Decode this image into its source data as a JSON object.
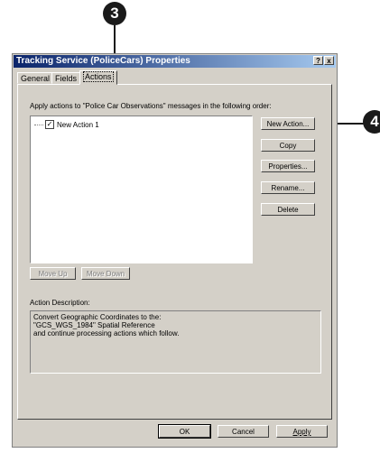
{
  "callouts": {
    "step3": "3",
    "step4": "4"
  },
  "window": {
    "title": "Tracking Service (PoliceCars) Properties",
    "help_button": "?",
    "close_button": "x"
  },
  "tabs": [
    {
      "label": "General"
    },
    {
      "label": "Fields"
    },
    {
      "label": "Actions",
      "active": true
    }
  ],
  "actions": {
    "instruction": "Apply actions to \"Police Car Observations\" messages in the following order:",
    "items": [
      {
        "label": "New Action 1",
        "checked": true
      }
    ],
    "buttons": {
      "new_action": "New Action...",
      "copy": "Copy",
      "properties": "Properties...",
      "rename": "Rename...",
      "delete": "Delete",
      "move_up": "Move Up",
      "move_down": "Move Down"
    },
    "description_label": "Action Description:",
    "description": "Convert Geographic Coordinates to the:\n\"GCS_WGS_1984\" Spatial Reference\nand continue processing actions which follow."
  },
  "footer": {
    "ok": "OK",
    "cancel": "Cancel",
    "apply": "Apply"
  },
  "colors": {
    "dialog": "#d4d0c8",
    "title_start": "#0a246a",
    "title_end": "#a6caf0",
    "callout": "#1a1a1a"
  }
}
